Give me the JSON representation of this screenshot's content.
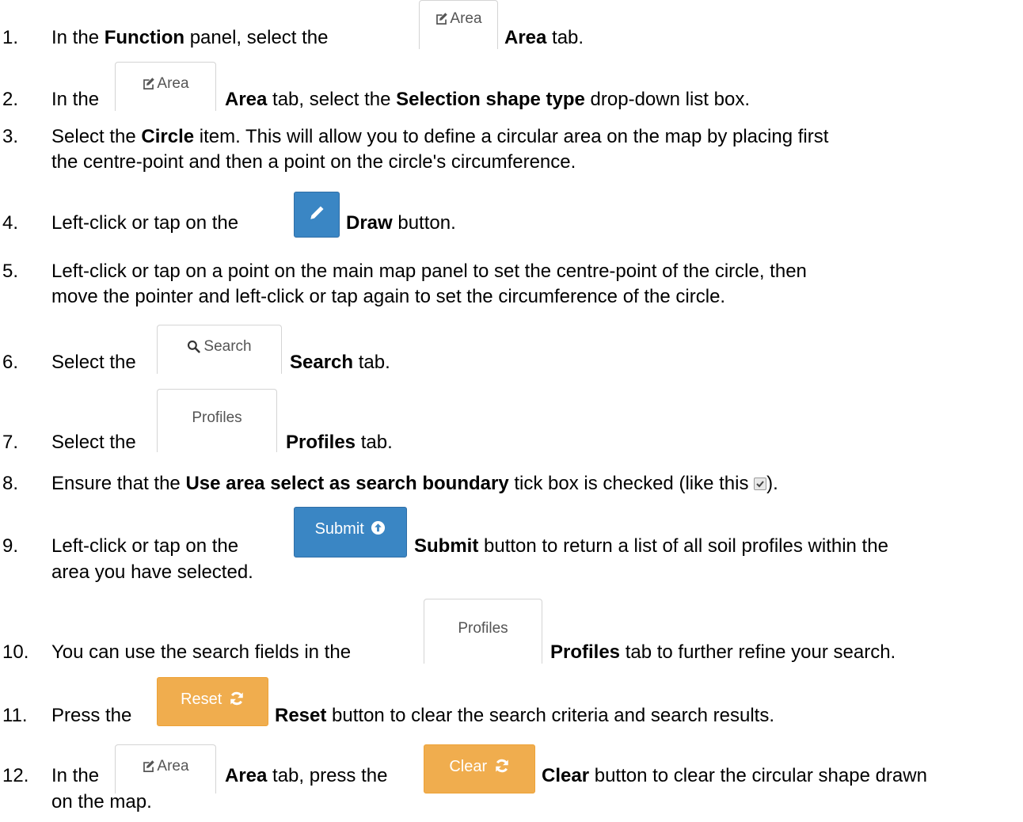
{
  "steps": [
    {
      "num": "1.",
      "parts": [
        "In the ",
        "Function",
        " panel, select the ",
        "Area",
        " tab."
      ]
    },
    {
      "num": "2.",
      "parts": [
        "In the ",
        "Area",
        " tab, select the ",
        "Selection shape type",
        " drop-down list box."
      ]
    },
    {
      "num": "3.",
      "parts": [
        "Select the ",
        "Circle",
        " item. This will allow you to define a circular area on the map by placing first",
        "the centre-point and then a point on the circle's circumference."
      ]
    },
    {
      "num": "4.",
      "parts": [
        "Left-click or tap on the ",
        "Draw",
        " button."
      ]
    },
    {
      "num": "5.",
      "parts": [
        "Left-click or tap on a point on the main map panel to set the centre-point of the circle, then",
        "move the pointer and left-click or tap again to set the circumference of the circle."
      ]
    },
    {
      "num": "6.",
      "parts": [
        "Select the ",
        "Search",
        " tab."
      ]
    },
    {
      "num": "7.",
      "parts": [
        "Select the ",
        "Profiles",
        " tab."
      ]
    },
    {
      "num": "8.",
      "parts": [
        "Ensure that the ",
        "Use area select as search boundary",
        " tick box is checked (like this ",
        ")."
      ]
    },
    {
      "num": "9.",
      "parts": [
        "Left-click or tap on the ",
        "Submit",
        " button to return a list of all soil profiles within the",
        "area you have selected."
      ]
    },
    {
      "num": "10.",
      "parts": [
        "You can use the search fields in the ",
        "Profiles",
        " tab to further refine your search."
      ]
    },
    {
      "num": "11.",
      "parts": [
        "Press the ",
        "Reset",
        " button to clear the search criteria and search results."
      ]
    },
    {
      "num": "12.",
      "parts": [
        "In the ",
        "Area",
        " tab, press the ",
        "Clear",
        " button to clear the circular shape drawn",
        "on the map."
      ]
    }
  ],
  "buttons": {
    "area": "Area",
    "search": "Search",
    "profiles": "Profiles",
    "submit": "Submit",
    "reset": "Reset",
    "clear": "Clear"
  },
  "icons": {
    "area": "edit-icon",
    "search": "search-icon",
    "draw": "pencil-icon",
    "submit": "arrow-up-circle-icon",
    "reset": "refresh-icon",
    "clear": "refresh-icon",
    "tickbox": "checkbox-checked-icon"
  },
  "colors": {
    "blue_button": "#3a86c4",
    "orange_button": "#f0ad4e",
    "tab_border": "#d4d4d4"
  }
}
